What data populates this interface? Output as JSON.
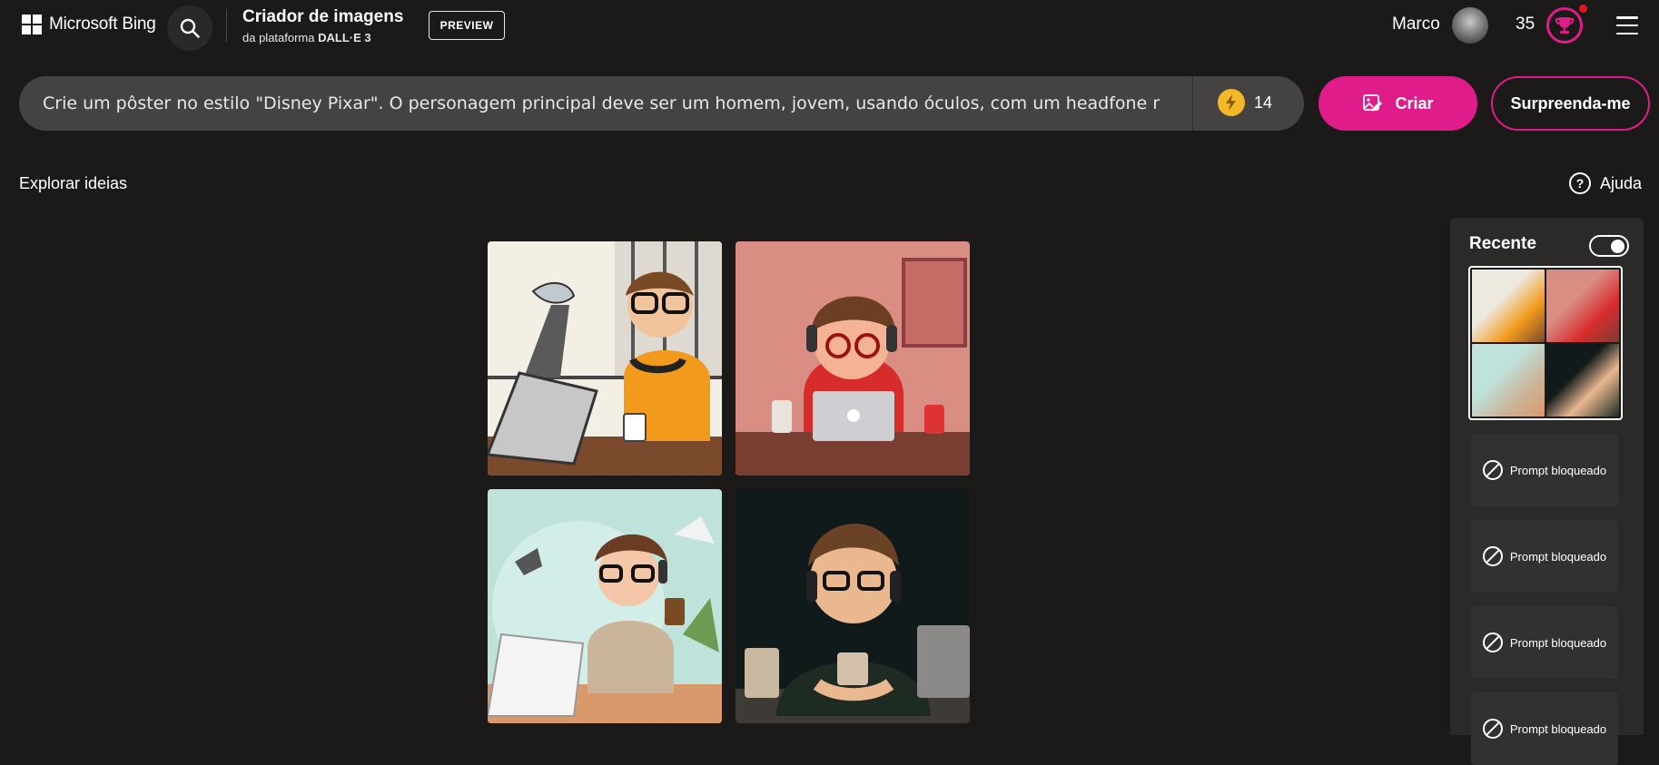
{
  "header": {
    "brand": "Microsoft Bing",
    "title": "Criador de imagens",
    "subtitle_prefix": "da plataforma",
    "subtitle_model": "DALL·E 3",
    "preview_label": "PREVIEW",
    "user_name": "Marco",
    "points": "35"
  },
  "prompt": {
    "value": "Crie um pôster no estilo \"Disney Pixar\". O personagem principal deve ser um homem, jovem, usando óculos, com um headfone na cabeça",
    "boosts": "14",
    "create_label": "Criar",
    "surprise_label": "Surpreenda-me"
  },
  "explore": {
    "label": "Explorar ideias",
    "help_label": "Ajuda"
  },
  "recent": {
    "label": "Recente",
    "toggle_on": true,
    "blocked_items": [
      "Prompt bloqueado",
      "Prompt bloqueado",
      "Prompt bloqueado",
      "Prompt bloqueado"
    ]
  },
  "colors": {
    "background": "#1b1a19",
    "accent": "#e01c8a",
    "prompt_bg": "#444342",
    "panel_bg": "#2b2a29",
    "coin": "#f2b827"
  },
  "icons": {
    "search": "search-icon",
    "boost": "lightning-icon",
    "create": "image-edit-icon",
    "help": "question-circle-icon",
    "blocked": "blocked-icon",
    "trophy": "trophy-icon",
    "menu": "hamburger-icon"
  }
}
